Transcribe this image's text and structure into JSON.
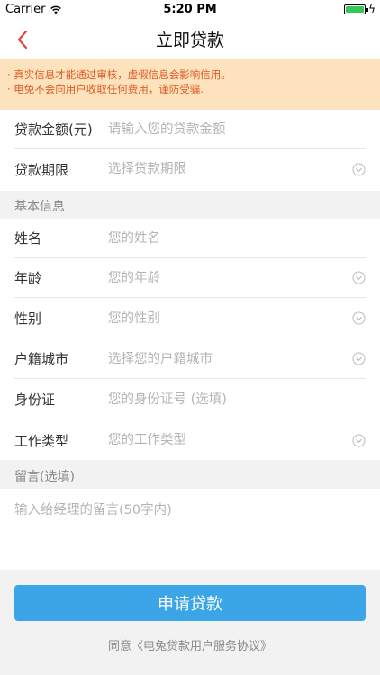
{
  "status": {
    "carrier": "Carrier",
    "time": "5:20 PM"
  },
  "nav": {
    "title": "立即贷款"
  },
  "notice": {
    "line1": "· 真实信息才能通过审核，虚假信息会影响信用。",
    "line2": "· 电兔不会向用户收取任何费用，谨防受骗."
  },
  "loan": {
    "amount_label": "贷款金额(元)",
    "amount_placeholder": "请输入您的贷款金额",
    "term_label": "贷款期限",
    "term_placeholder": "选择贷款期限"
  },
  "basic_info": {
    "header": "基本信息",
    "name_label": "姓名",
    "name_placeholder": "您的姓名",
    "age_label": "年龄",
    "age_placeholder": "您的年龄",
    "gender_label": "性别",
    "gender_placeholder": "您的性别",
    "city_label": "户籍城市",
    "city_placeholder": "选择您的户籍城市",
    "id_label": "身份证",
    "id_placeholder": "您的身份证号 (选填)",
    "job_label": "工作类型",
    "job_placeholder": "您的工作类型"
  },
  "message": {
    "header": "留言(选填)",
    "placeholder": "输入给经理的留言(50字内)"
  },
  "apply_button": "申请贷款",
  "agreement": "同意《电兔贷款用户服务协议》",
  "colors": {
    "accent": "#3ba5e8",
    "back": "#e2443b",
    "notice_bg": "#fde3bd",
    "notice_text": "#e05a24"
  }
}
